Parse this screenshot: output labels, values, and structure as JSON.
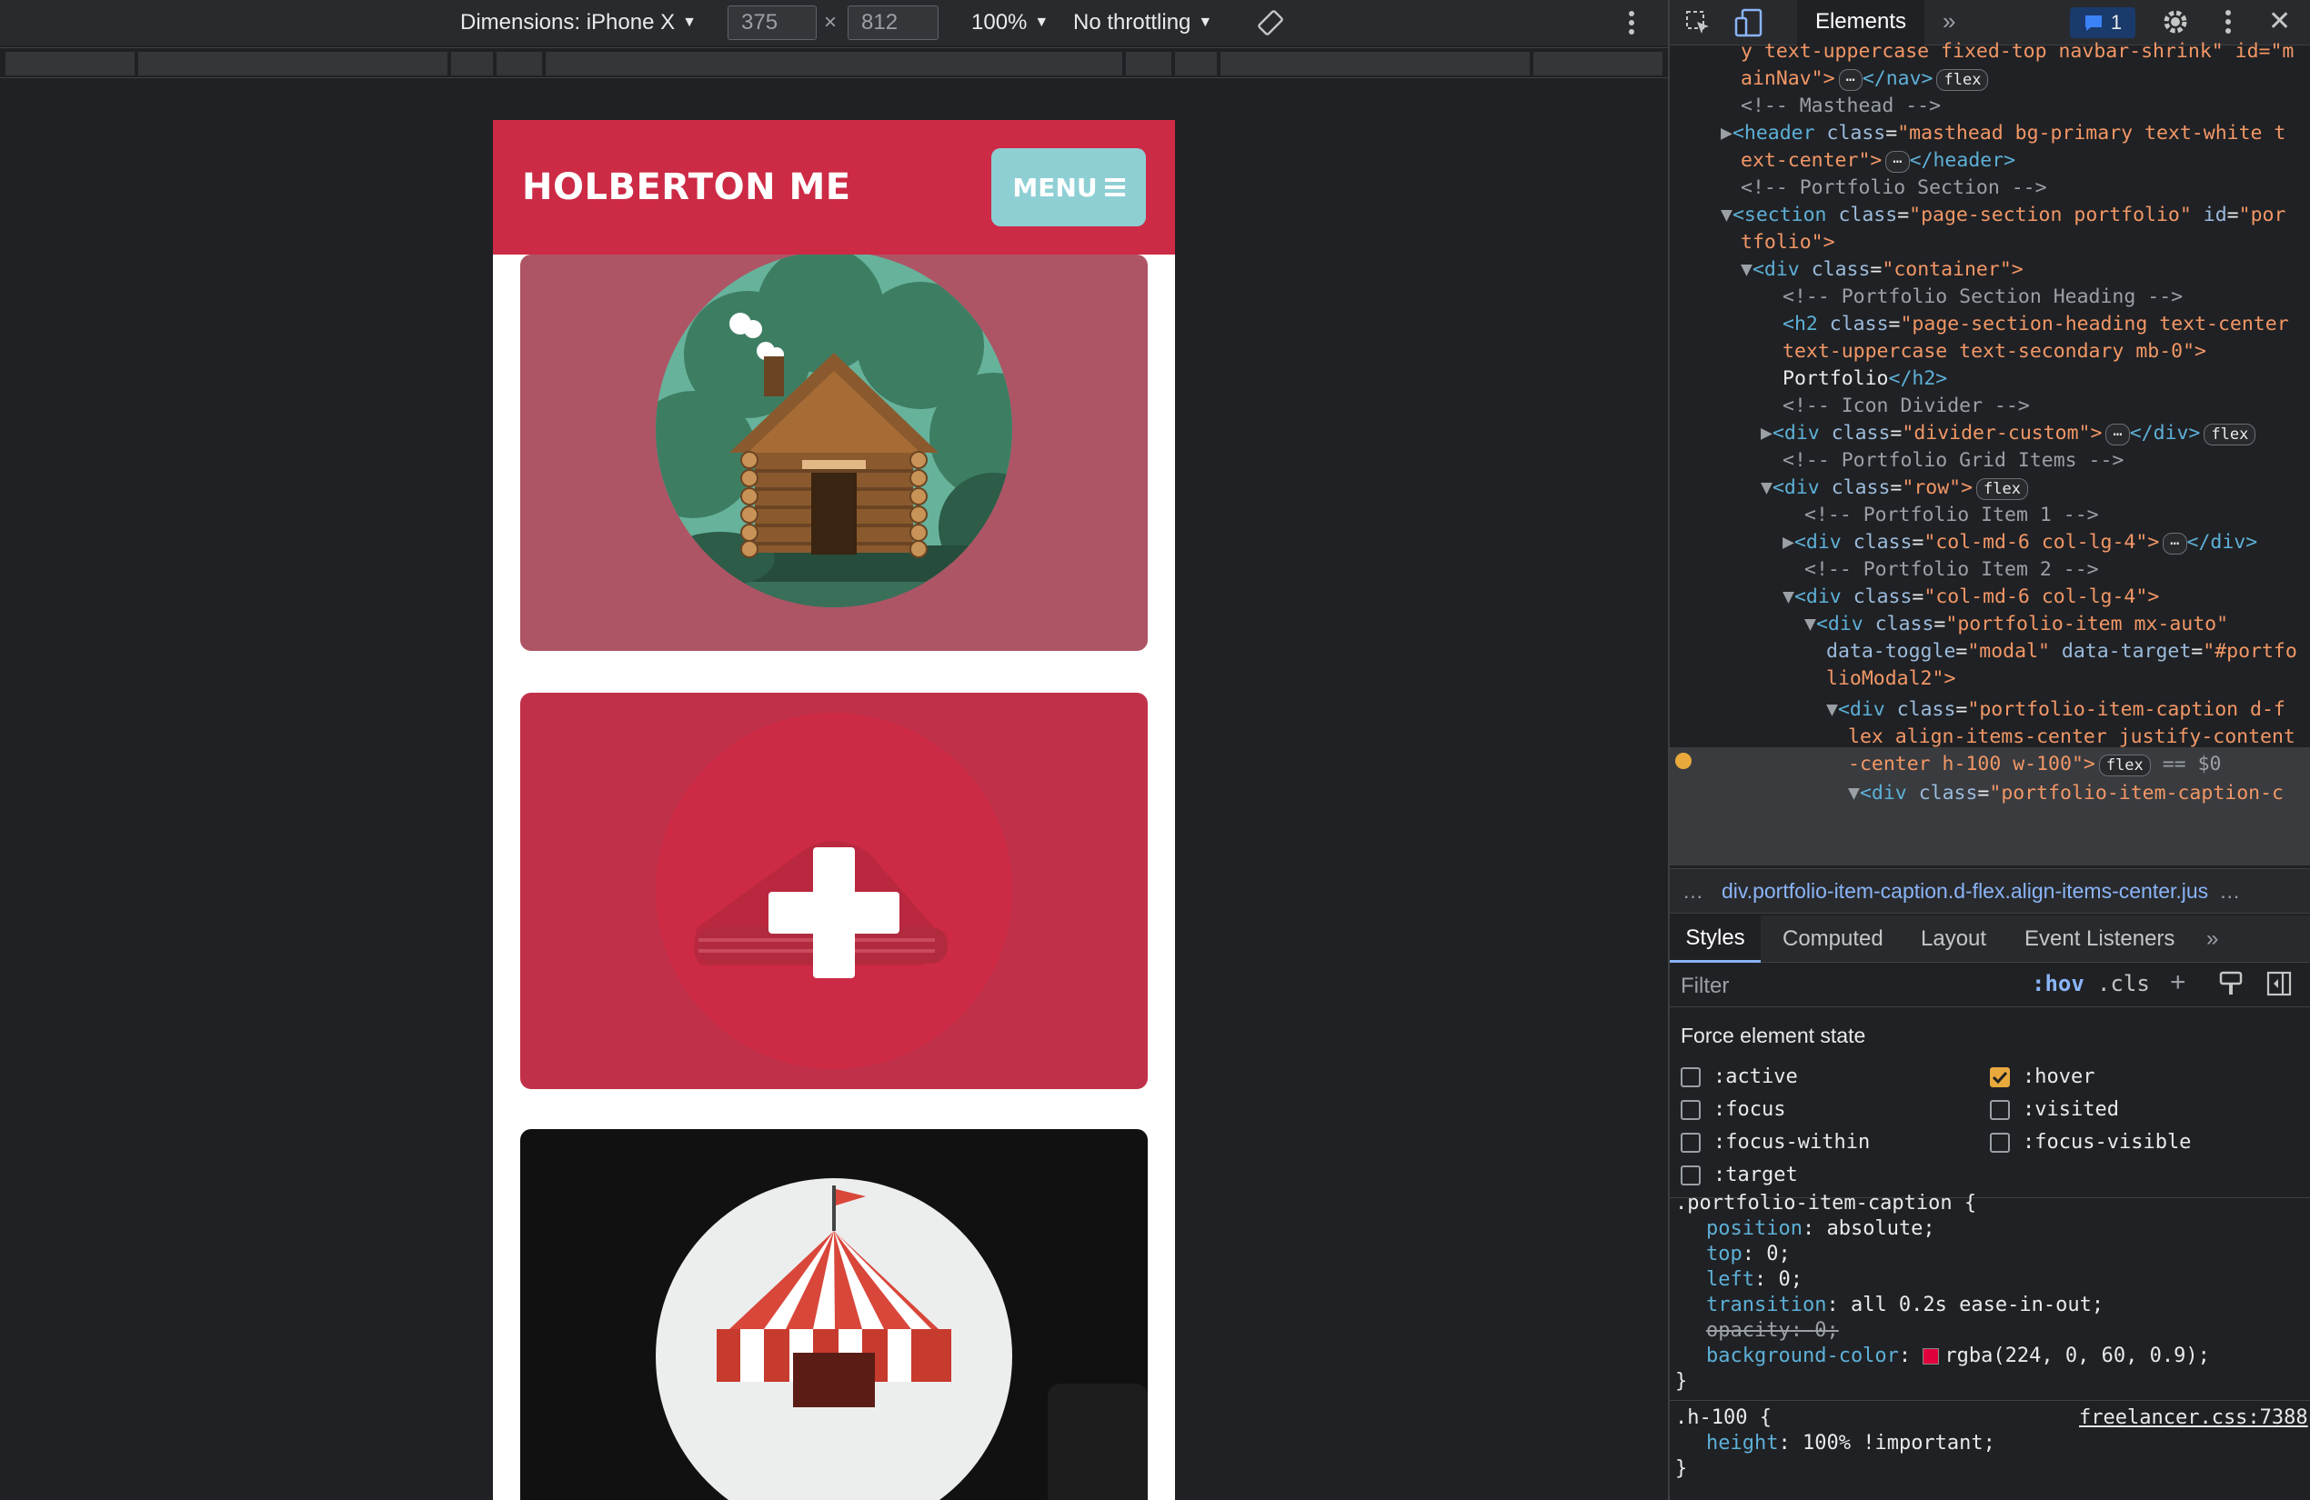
{
  "toolbar": {
    "dimensions_label": "Dimensions: iPhone X",
    "width_value": "375",
    "times": "×",
    "height_value": "812",
    "zoom": "100%",
    "throttling": "No throttling"
  },
  "site": {
    "brand": "HOLBERTON ME",
    "menu_label": "MENU",
    "colors": {
      "navbar": "#cc2a45",
      "menu_button": "#8ecfd4",
      "card_hover": "#c13049"
    }
  },
  "devtools": {
    "tab_elements": "Elements",
    "issues_count": "1",
    "elements_lines": [
      "y text-uppercase fixed-top navbar-shrink\" id=\"m",
      "ainNav\">",
      "</nav>",
      "<!-- Masthead -->",
      "<header",
      "class",
      "\"masthead bg-primary text-white t",
      "ext-center\">",
      "</header>",
      "<!-- Portfolio Section -->",
      "<section",
      "\"page-section portfolio\"",
      "id",
      "\"por",
      "tfolio\">",
      "<div",
      "\"container\">",
      "<!-- Portfolio Section Heading -->",
      "<h2",
      "\"page-section-heading text-center",
      "text-uppercase text-secondary mb-0\">",
      "Portfolio",
      "</h2>",
      "<!-- Icon Divider -->",
      "\"divider-custom\">",
      "</div>",
      "<!-- Portfolio Grid Items -->",
      "\"row\">",
      "<!-- Portfolio Item 1 -->",
      "\"col-md-6 col-lg-4\">",
      "<!-- Portfolio Item 2 -->",
      "\"portfolio-item mx-auto\"",
      "data-toggle",
      "\"modal\"",
      "data-target",
      "\"#portfo",
      "lioModal2\">",
      "\"portfolio-item-caption d-f",
      "lex align-items-center justify-content",
      "-center h-100 w-100\">",
      "== $0",
      "\"portfolio-item-caption-c"
    ],
    "pill_flex": "flex",
    "breadcrumb": "div.portfolio-item-caption.d-flex.align-items-center.jus",
    "subtabs": [
      "Styles",
      "Computed",
      "Layout",
      "Event Listeners"
    ],
    "filter_placeholder": "Filter",
    "hov": ":hov",
    "cls": ".cls",
    "force_state_title": "Force element state",
    "states": [
      ":active",
      ":hover",
      ":focus",
      ":visited",
      ":focus-within",
      ":focus-visible",
      ":target"
    ],
    "css_rule1_selector": ".portfolio-item-caption {",
    "css_rule1": [
      {
        "prop": "position",
        "val": "absolute;"
      },
      {
        "prop": "top",
        "val": "0;"
      },
      {
        "prop": "left",
        "val": "0;"
      },
      {
        "prop": "transition",
        "val": "all 0.2s ease-in-out;"
      },
      {
        "prop": "opacity",
        "val": "0;"
      },
      {
        "prop": "background-color",
        "val": "rgba(224, 0, 60, 0.9);"
      }
    ],
    "css_close": "}",
    "css_rule2_selector": ".h-100 {",
    "css_rule2_source": "freelancer.css:7388",
    "css_rule2": [
      {
        "prop": "height",
        "val": "100% !important;"
      }
    ]
  }
}
